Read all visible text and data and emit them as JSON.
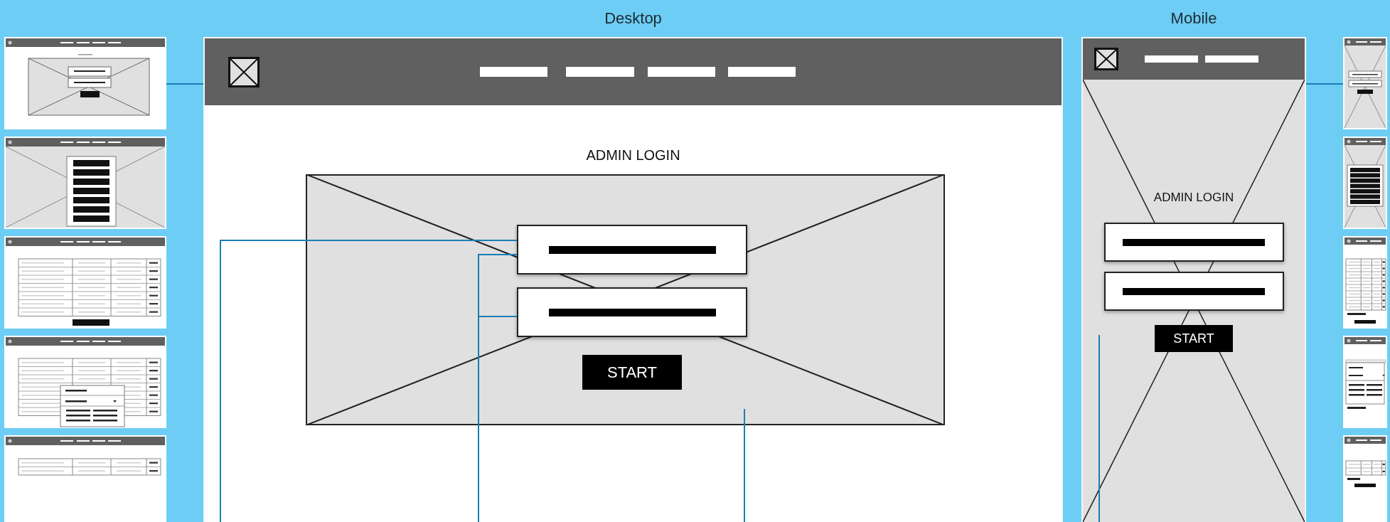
{
  "sections": [
    {
      "label": "Desktop"
    },
    {
      "label": "Mobile"
    }
  ],
  "desktop_thumbnails": [
    {
      "kind": "login"
    },
    {
      "kind": "menu"
    },
    {
      "kind": "table"
    },
    {
      "kind": "dialog"
    },
    {
      "kind": "table-short"
    }
  ],
  "desktop": {
    "title": "ADMIN LOGIN",
    "button": "START"
  },
  "mobile": {
    "title": "ADMIN LOGIN",
    "button": "START"
  },
  "mobile_thumbnails": [
    {
      "kind": "login"
    },
    {
      "kind": "menu"
    },
    {
      "kind": "table"
    },
    {
      "kind": "dialog"
    },
    {
      "kind": "table-short"
    }
  ]
}
